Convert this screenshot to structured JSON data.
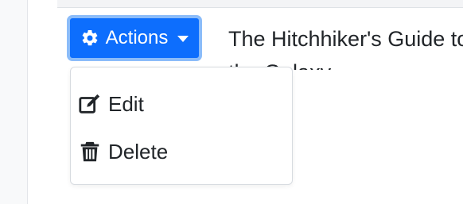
{
  "toolbar": {
    "actions_label": "Actions",
    "actions_icon": "gear-icon",
    "caret_icon": "caret-down-icon",
    "accent_color": "#0d6efd"
  },
  "content": {
    "title": "The Hitchhiker's Guide to the Galaxy"
  },
  "dropdown": {
    "items": [
      {
        "label": "Edit",
        "icon": "edit-icon"
      },
      {
        "label": "Delete",
        "icon": "trash-icon"
      }
    ]
  }
}
